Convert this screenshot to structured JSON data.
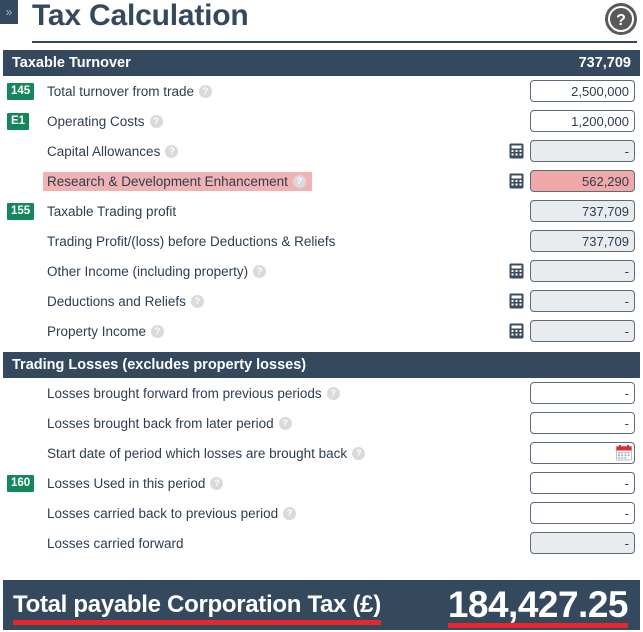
{
  "window": {
    "collapse_glyph": "»",
    "title": "Tax Calculation",
    "help_icon": "help-circle-icon"
  },
  "colors": {
    "header_navy": "#34495e",
    "badge_green": "#15875c",
    "highlight_pink": "#f0b2b2",
    "field_pink": "#f0a8a8",
    "readonly_grey": "#e9ecee",
    "underline_red": "#e8272c"
  },
  "sections": [
    {
      "title": "Taxable Turnover",
      "value": "737,709",
      "rows": [
        {
          "badge": "145",
          "label": "Total turnover from trade",
          "help": true,
          "calculator": false,
          "value": "2,500,000",
          "readonly": false,
          "highlight": false,
          "name": "total-turnover-from-trade"
        },
        {
          "badge": "E1",
          "label": "Operating Costs",
          "help": true,
          "calculator": false,
          "value": "1,200,000",
          "readonly": false,
          "highlight": false,
          "name": "operating-costs"
        },
        {
          "badge": "",
          "label": "Capital Allowances",
          "help": true,
          "calculator": true,
          "value": "-",
          "readonly": true,
          "highlight": false,
          "name": "capital-allowances"
        },
        {
          "badge": "",
          "label": "Research & Development Enhancement",
          "help": true,
          "calculator": true,
          "value": "562,290",
          "readonly": false,
          "highlight": true,
          "name": "research-and-development-enhancement"
        },
        {
          "badge": "155",
          "label": "Taxable Trading profit",
          "help": false,
          "calculator": false,
          "value": "737,709",
          "readonly": true,
          "highlight": false,
          "name": "taxable-trading-profit"
        },
        {
          "badge": "",
          "label": "Trading Profit/(loss) before Deductions & Reliefs",
          "help": false,
          "calculator": false,
          "value": "737,709",
          "readonly": true,
          "highlight": false,
          "name": "trading-profit-before-deductions-and-reliefs"
        },
        {
          "badge": "",
          "label": "Other Income (including property)",
          "help": true,
          "calculator": true,
          "value": "-",
          "readonly": true,
          "highlight": false,
          "name": "other-income-including-property"
        },
        {
          "badge": "",
          "label": "Deductions and Reliefs",
          "help": true,
          "calculator": true,
          "value": "-",
          "readonly": true,
          "highlight": false,
          "name": "deductions-and-reliefs"
        },
        {
          "badge": "",
          "label": "Property Income",
          "help": true,
          "calculator": true,
          "value": "-",
          "readonly": true,
          "highlight": false,
          "name": "property-income"
        }
      ]
    },
    {
      "title": "Trading Losses (excludes property losses)",
      "value": "",
      "rows": [
        {
          "badge": "",
          "label": "Losses brought forward from previous periods",
          "help": true,
          "calculator": false,
          "value": "-",
          "readonly": false,
          "highlight": false,
          "name": "losses-brought-forward-from-previous-periods"
        },
        {
          "badge": "",
          "label": "Losses brought back from later period",
          "help": true,
          "calculator": false,
          "value": "-",
          "readonly": false,
          "highlight": false,
          "name": "losses-brought-back-from-later-period"
        },
        {
          "badge": "",
          "label": "Start date of period which losses are brought back",
          "help": true,
          "calculator": false,
          "value": "",
          "readonly": false,
          "highlight": false,
          "datepicker": true,
          "name": "start-date-of-period-losses-brought-back"
        },
        {
          "badge": "160",
          "label": "Losses Used in this period",
          "help": true,
          "calculator": false,
          "value": "-",
          "readonly": false,
          "highlight": false,
          "name": "losses-used-in-this-period"
        },
        {
          "badge": "",
          "label": "Losses carried back to previous period",
          "help": true,
          "calculator": false,
          "value": "-",
          "readonly": false,
          "highlight": false,
          "name": "losses-carried-back-to-previous-period"
        },
        {
          "badge": "",
          "label": "Losses carried forward",
          "help": false,
          "calculator": false,
          "value": "-",
          "readonly": true,
          "highlight": false,
          "name": "losses-carried-forward"
        }
      ]
    }
  ],
  "total": {
    "label": "Total payable Corporation Tax (£)",
    "value": "184,427.25"
  }
}
